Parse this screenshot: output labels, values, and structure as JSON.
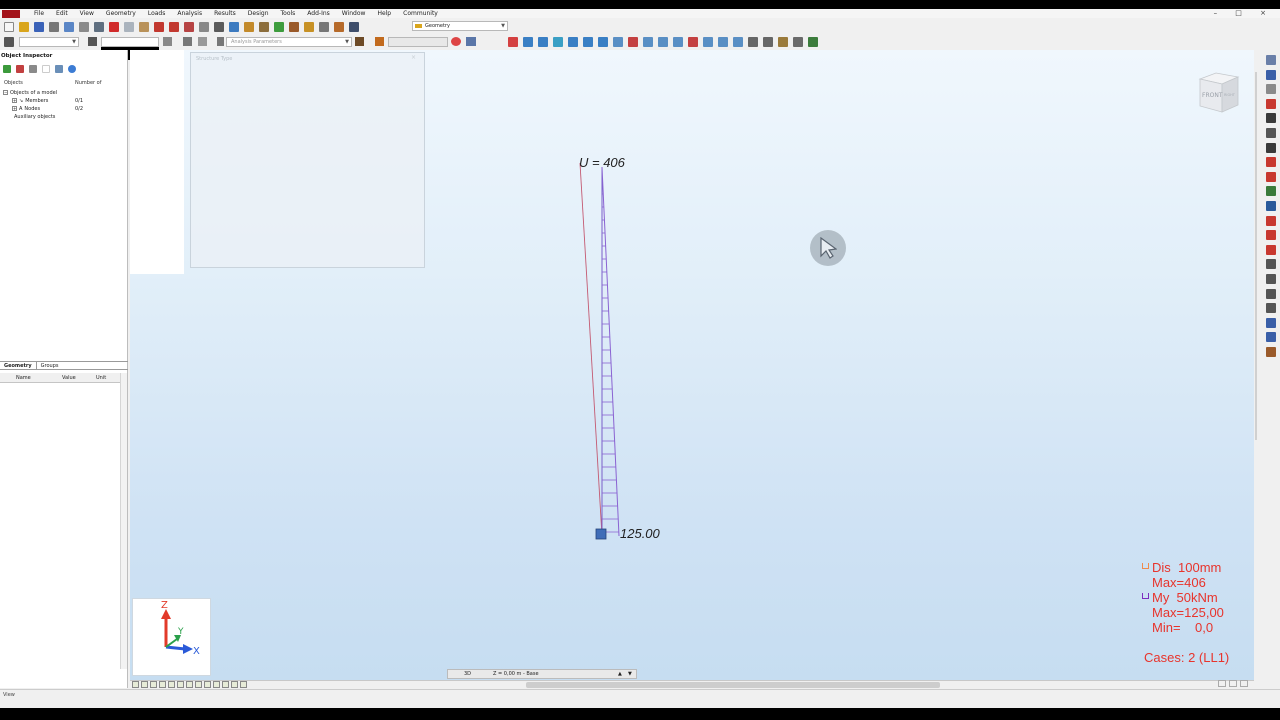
{
  "menu": {
    "items": [
      "File",
      "Edit",
      "View",
      "Geometry",
      "Loads",
      "Analysis",
      "Results",
      "Design",
      "Tools",
      "Add-Ins",
      "Window",
      "Help",
      "Community"
    ],
    "window_controls": "– □ ×"
  },
  "toolbar": {
    "layout_combo": "Geometry",
    "analysis_combo": "Analysis Parameters"
  },
  "inspector": {
    "title": "Object Inspector",
    "col_objects": "Objects",
    "col_number": "Number of",
    "tree": [
      {
        "label": "Objects of a model",
        "count": "",
        "indent": 0,
        "expander": "−"
      },
      {
        "label": "Members",
        "count": "0/1",
        "indent": 1,
        "expander": "+"
      },
      {
        "label": "Nodes",
        "count": "0/2",
        "indent": 1,
        "expander": "+"
      },
      {
        "label": "Auxiliary objects",
        "count": "",
        "indent": 0,
        "expander": ""
      }
    ],
    "tabs": [
      "Geometry",
      "Groups"
    ],
    "prop_cols": [
      "Name",
      "Value",
      "Unit"
    ]
  },
  "float_panel": {
    "title": "Structure Type"
  },
  "model": {
    "top_label": "U = 406",
    "bottom_label": "125.00"
  },
  "view_cube": {
    "front": "FRONT",
    "right": "RIGHT"
  },
  "axis": {
    "x": "X",
    "y": "Y",
    "z": "Z"
  },
  "legend": {
    "lines": [
      "Dis  100mm",
      "Max=406",
      "My  50kNm",
      "Max=125,00",
      "Min=    0,0"
    ],
    "cases": "Cases: 2 (LL1)",
    "dis_color": "#f08a4b",
    "my_color": "#7b2fbe"
  },
  "view_control": {
    "mode": "3D",
    "level": "Z = 0,00 m - Base"
  },
  "status": {
    "text": "View"
  },
  "colors": {
    "background_top": "#f0f7fd",
    "background_bottom": "#c6ddf1",
    "deformed_line": "#c45a72",
    "member": "#7a5fc9",
    "label": "#e8342c"
  }
}
